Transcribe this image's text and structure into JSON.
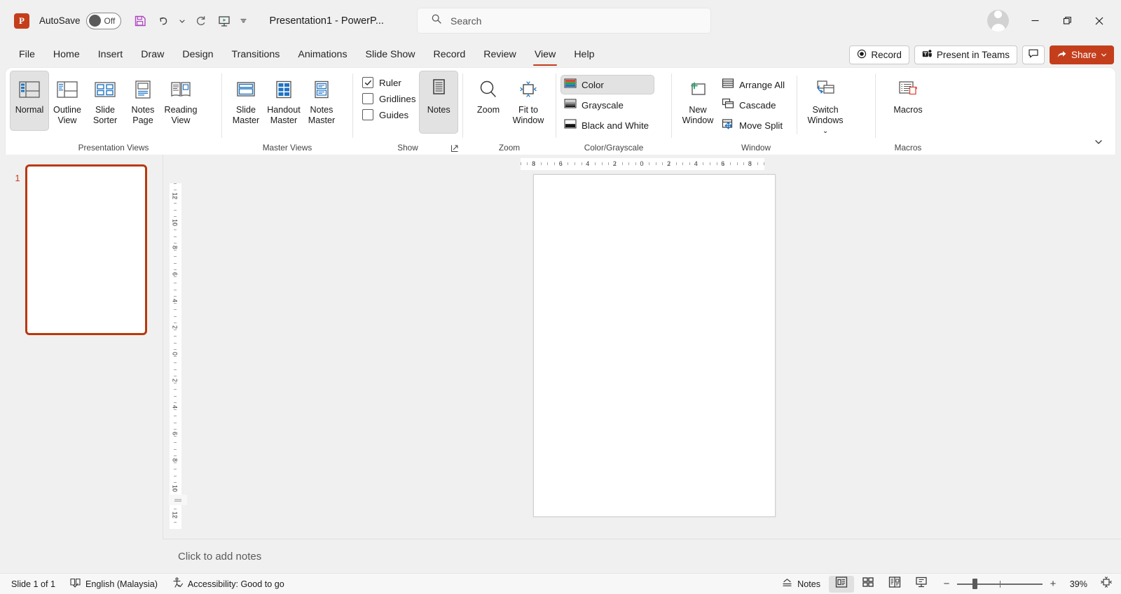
{
  "titlebar": {
    "logo_alt": "P",
    "autosave_label": "AutoSave",
    "autosave_state": "Off",
    "save_title": "Save",
    "undo_title": "Undo",
    "undo_more_title": "More undo options",
    "redo_title": "Redo",
    "present_title": "Start from Beginning",
    "qat_more_title": "Customize Quick Access Toolbar",
    "document_title": "Presentation1  -  PowerP...",
    "search_placeholder": "Search",
    "account_title": "Account",
    "minimize_title": "Minimize",
    "restore_title": "Restore Down",
    "close_title": "Close"
  },
  "tabs": [
    {
      "label": "File",
      "active": false
    },
    {
      "label": "Home",
      "active": false
    },
    {
      "label": "Insert",
      "active": false
    },
    {
      "label": "Draw",
      "active": false
    },
    {
      "label": "Design",
      "active": false
    },
    {
      "label": "Transitions",
      "active": false
    },
    {
      "label": "Animations",
      "active": false
    },
    {
      "label": "Slide Show",
      "active": false
    },
    {
      "label": "Record",
      "active": false
    },
    {
      "label": "Review",
      "active": false
    },
    {
      "label": "View",
      "active": true
    },
    {
      "label": "Help",
      "active": false
    }
  ],
  "tab_actions": {
    "record_label": "Record",
    "present_in_teams_label": "Present in Teams",
    "comments_title": "Comments",
    "share_label": "Share"
  },
  "ribbon": {
    "groups": [
      {
        "name": "Presentation Views",
        "label": "Presentation Views",
        "buttons": [
          {
            "label": "Normal",
            "selected": true
          },
          {
            "label": "Outline View",
            "selected": false
          },
          {
            "label": "Slide Sorter",
            "selected": false
          },
          {
            "label": "Notes Page",
            "selected": false
          },
          {
            "label": "Reading View",
            "selected": false
          }
        ]
      },
      {
        "name": "Master Views",
        "label": "Master Views",
        "buttons": [
          {
            "label": "Slide Master",
            "selected": false
          },
          {
            "label": "Handout Master",
            "selected": false
          },
          {
            "label": "Notes Master",
            "selected": false
          }
        ]
      },
      {
        "name": "Show",
        "label": "Show",
        "checkboxes": [
          {
            "label": "Ruler",
            "checked": true
          },
          {
            "label": "Gridlines",
            "checked": false
          },
          {
            "label": "Guides",
            "checked": false
          }
        ],
        "buttons": [
          {
            "label": "Notes",
            "selected": true
          }
        ],
        "launcher_title": "Grid and Guides"
      },
      {
        "name": "Zoom",
        "label": "Zoom",
        "buttons": [
          {
            "label": "Zoom",
            "selected": false
          },
          {
            "label": "Fit to Window",
            "selected": false
          }
        ]
      },
      {
        "name": "Color/Grayscale",
        "label": "Color/Grayscale",
        "items": [
          {
            "label": "Color",
            "selected": true
          },
          {
            "label": "Grayscale",
            "selected": false
          },
          {
            "label": "Black and White",
            "selected": false
          }
        ]
      },
      {
        "name": "Window",
        "label": "Window",
        "buttons": [
          {
            "label": "New Window",
            "selected": false
          }
        ],
        "items": [
          {
            "label": "Arrange All",
            "selected": false
          },
          {
            "label": "Cascade",
            "selected": false
          },
          {
            "label": "Move Split",
            "selected": false
          }
        ],
        "split_buttons": [
          {
            "label": "Switch Windows",
            "selected": false
          }
        ]
      },
      {
        "name": "Macros",
        "label": "Macros",
        "buttons": [
          {
            "label": "Macros",
            "selected": false
          }
        ]
      }
    ],
    "collapse_title": "Collapse the Ribbon"
  },
  "thumbnails": {
    "slides": [
      {
        "number": "1",
        "selected": true
      }
    ]
  },
  "rulers": {
    "horizontal_ticks": [
      "8",
      "6",
      "4",
      "2",
      "0",
      "2",
      "4",
      "6",
      "8"
    ],
    "vertical_ticks": [
      "12",
      "10",
      "8",
      "6",
      "4",
      "2",
      "0",
      "2",
      "4",
      "6",
      "8",
      "10",
      "12"
    ]
  },
  "notes": {
    "placeholder": "Click to add notes",
    "resize_title": "Resize notes pane"
  },
  "statusbar": {
    "slide_count": "Slide 1 of 1",
    "language_title": "Spelling and Grammar Check",
    "language": "English (Malaysia)",
    "accessibility": "Accessibility: Good to go",
    "notes_label": "Notes",
    "views": [
      {
        "name": "normal-view",
        "title": "Normal",
        "active": true
      },
      {
        "name": "slide-sorter-view",
        "title": "Slide Sorter",
        "active": false
      },
      {
        "name": "reading-view",
        "title": "Reading View",
        "active": false
      },
      {
        "name": "slide-show-view",
        "title": "Slide Show",
        "active": false
      }
    ],
    "zoom_out_label": "−",
    "zoom_in_label": "+",
    "zoom_percent": "39%",
    "fit_title": "Fit slide to current window"
  },
  "colors": {
    "accent": "#c43e1c",
    "selection": "#b9390f",
    "ribbon_bg": "#ffffff",
    "chrome_bg": "#f0f0f0",
    "statusbar_bg": "#f7f7f7"
  }
}
